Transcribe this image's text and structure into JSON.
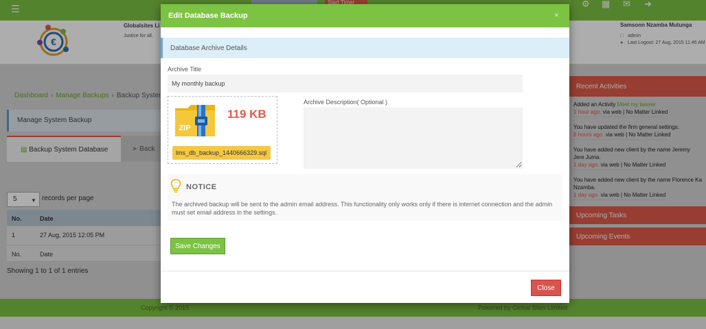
{
  "background": {
    "topbar": {
      "timer_label": "Start Timer"
    },
    "header": {
      "org_name": "Globalsites Li",
      "org_tagline": "Justice for all.",
      "user_name": "Samsonn Nzamba Mutunga",
      "user_role": "admin",
      "last_logout": "Last Logout: 27 Aug, 2015 11:46 AM"
    },
    "breadcrumb": {
      "items": [
        "Dashboard",
        "Manage Backups",
        "Backup Syster"
      ]
    },
    "panel_title": "Manage System Backup",
    "tabs": [
      "Backup System Database",
      "Back"
    ],
    "table": {
      "length_value": "5",
      "length_label": "records per page",
      "headers": [
        "No.",
        "Date"
      ],
      "rows": [
        [
          "1",
          "27 Aug, 2015 12:05 PM"
        ]
      ],
      "footer": [
        "No.",
        "Date"
      ],
      "info": "Showing 1 to 1 of 1 entries"
    },
    "sidebar": {
      "recent_title": "Recent Activities",
      "activities": [
        {
          "text": "Added an Activity",
          "link": "Meet my lawyer",
          "when": "1 hour ago.",
          "meta": "via web | No Matter Linked"
        },
        {
          "text": "You have updated the firm general settings.",
          "link": "",
          "when": "8 hours ago.",
          "meta": "via web | No Matter Linked"
        },
        {
          "text": "You have added new client by the name Jeremy Jere Juma.",
          "link": "",
          "when": "1 day ago.",
          "meta": "via web | No Matter Linked"
        },
        {
          "text": "You have added new client by the name Florence Ka Nzamba.",
          "link": "",
          "when": "1 day ago.",
          "meta": "via web | No Matter Linked"
        }
      ],
      "upcoming_tasks": "Upcoming Tasks",
      "upcoming_events": "Upcoming Events"
    },
    "footer": {
      "copyright": "Copyright © 2015",
      "powered": "Powered by Global Sites Limited"
    }
  },
  "modal": {
    "title": "Edit Database Backup",
    "close_x": "×",
    "section_title": "Database Archive Details",
    "archive_title_label": "Archive Title",
    "archive_title_value": "My monthly backup",
    "file_size": "119 KB",
    "file_name": "lms_db_backup_1440666329.sql",
    "zip_label": "ZIP",
    "description_label": "Archive Description( Optional )",
    "description_value": "",
    "notice_title": "NOTICE",
    "notice_text": "The archived backup will be sent to the admin email address. This functionality only works only if there is internet connection and the admin must set email address in the settings.",
    "save_label": "Save Changes",
    "close_label": "Close"
  },
  "colors": {
    "brand_green": "#7cc243",
    "danger_red": "#d9534f",
    "accent_red": "#e05a4a",
    "info_blue": "#dceef8",
    "zip_yellow": "#f5c842"
  }
}
